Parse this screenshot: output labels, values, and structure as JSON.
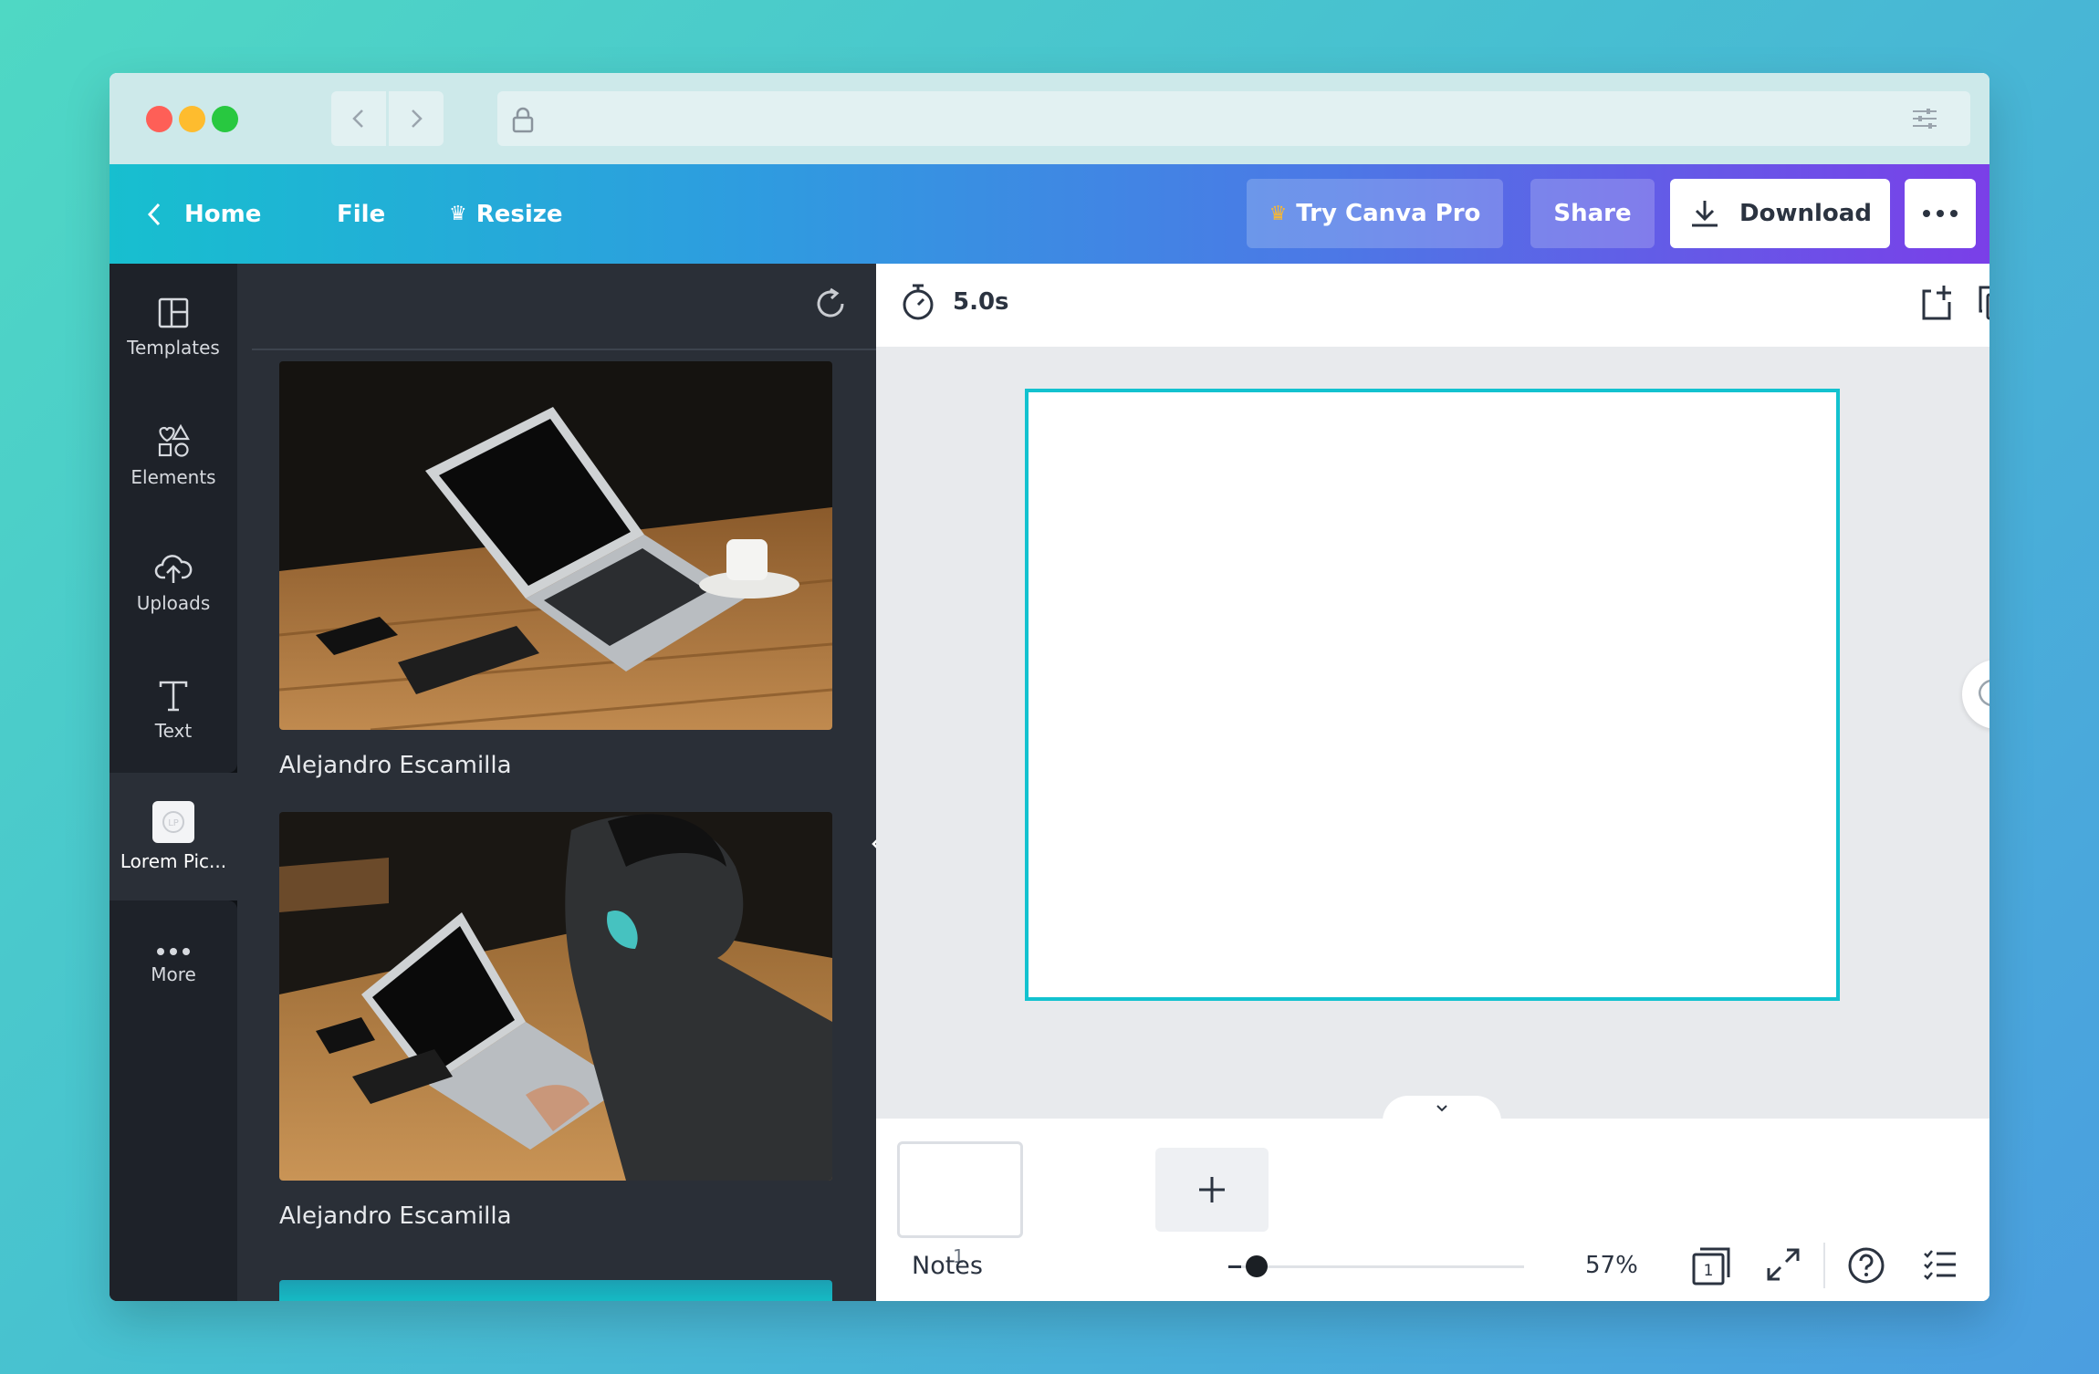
{
  "appbar": {
    "home_label": "Home",
    "file_label": "File",
    "resize_label": "Resize",
    "try_pro_label": "Try Canva Pro",
    "share_label": "Share",
    "download_label": "Download"
  },
  "rail": {
    "items": [
      {
        "label": "Templates",
        "icon": "templates-icon"
      },
      {
        "label": "Elements",
        "icon": "elements-icon"
      },
      {
        "label": "Uploads",
        "icon": "uploads-icon"
      },
      {
        "label": "Text",
        "icon": "text-icon"
      },
      {
        "label": "Lorem Pic...",
        "icon": "lorem-picsum-app-icon"
      },
      {
        "label": "More",
        "icon": "more-dots-icon"
      }
    ]
  },
  "panel": {
    "photos": [
      {
        "caption": "Alejandro Escamilla"
      },
      {
        "caption": "Alejandro Escamilla"
      }
    ]
  },
  "editor": {
    "duration": "5.0s",
    "page_number": "1"
  },
  "footer": {
    "notes_label": "Notes",
    "zoom": "57%",
    "page_count_badge": "1",
    "zoom_fraction": 0.57
  },
  "colors": {
    "selection": "#13c2cf",
    "rail_bg": "#1e2229",
    "panel_bg": "#2a2f37"
  }
}
